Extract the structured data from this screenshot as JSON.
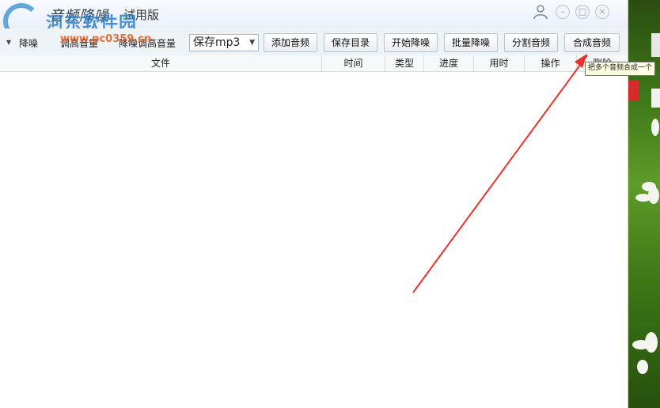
{
  "app": {
    "title": "音频降噪",
    "edition": "试用版"
  },
  "watermark": {
    "name": "河东软件园",
    "url": "www.pc0359.cn"
  },
  "toolbar": {
    "label_fragment_1": "降噪",
    "label_fragment_2": "调高音量",
    "label_fragment_3": "降噪调高音量",
    "format_select": "保存mp3",
    "buttons": {
      "add_audio": "添加音频",
      "save_dir": "保存目录",
      "start_denoise": "开始降噪",
      "batch_denoise": "批量降噪",
      "split_audio": "分割音频",
      "merge_audio": "合成音频"
    }
  },
  "table": {
    "columns": [
      "文件",
      "时间",
      "类型",
      "进度",
      "用时",
      "操作",
      "删除"
    ]
  },
  "tooltip": {
    "text": "把多个音频合成一个"
  },
  "window_controls": {
    "minimize": "–",
    "maximize": "□",
    "close": "×"
  },
  "colors": {
    "annotation_arrow": "#e8322a",
    "watermark_blue": "#2a7fd0",
    "watermark_orange": "#e45a1e"
  }
}
